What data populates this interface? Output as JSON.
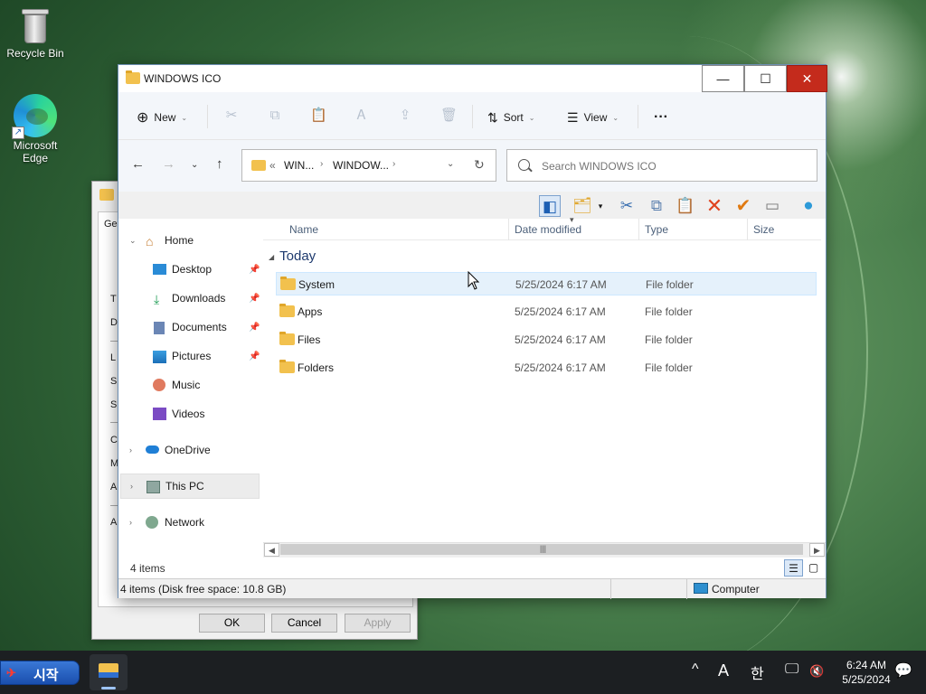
{
  "desktop": {
    "icons": [
      {
        "label": "Recycle Bin",
        "icon": "recycle-bin-icon"
      },
      {
        "label": "Microsoft\nEdge",
        "icon": "edge-icon"
      }
    ]
  },
  "background_dialog": {
    "tab": "Ge",
    "labels": [
      "T",
      "D",
      "L",
      "S",
      "S",
      "C",
      "M",
      "A",
      "A"
    ],
    "buttons": {
      "ok": "OK",
      "cancel": "Cancel",
      "apply": "Apply"
    }
  },
  "window": {
    "title": "WINDOWS ICO",
    "controls": {
      "minimize": "—",
      "maximize": "☐",
      "close": "✕"
    }
  },
  "command_bar": {
    "new_label": "New",
    "sort_label": "Sort",
    "view_label": "View",
    "more_label": "···"
  },
  "address": {
    "prefix": "«",
    "crumbs": [
      "WIN...",
      "WINDOW..."
    ],
    "search_placeholder": "Search WINDOWS ICO"
  },
  "nav_pane": {
    "items": [
      {
        "label": "Home",
        "icon": "home-icon",
        "expandable": true,
        "expanded": true
      },
      {
        "label": "Desktop",
        "icon": "desktop-icon",
        "pinned": true
      },
      {
        "label": "Downloads",
        "icon": "downloads-icon",
        "pinned": true
      },
      {
        "label": "Documents",
        "icon": "documents-icon",
        "pinned": true
      },
      {
        "label": "Pictures",
        "icon": "pictures-icon",
        "pinned": true
      },
      {
        "label": "Music",
        "icon": "music-icon"
      },
      {
        "label": "Videos",
        "icon": "videos-icon"
      },
      {
        "label": "OneDrive",
        "icon": "onedrive-icon",
        "expandable": true
      },
      {
        "label": "This PC",
        "icon": "this-pc-icon",
        "expandable": true,
        "selected": true
      },
      {
        "label": "Network",
        "icon": "network-icon",
        "expandable": true
      }
    ]
  },
  "file_list": {
    "columns": [
      "Name",
      "Date modified",
      "Type",
      "Size"
    ],
    "group": "Today",
    "rows": [
      {
        "name": "System",
        "date": "5/25/2024 6:17 AM",
        "type": "File folder"
      },
      {
        "name": "Apps",
        "date": "5/25/2024 6:17 AM",
        "type": "File folder"
      },
      {
        "name": "Files",
        "date": "5/25/2024 6:17 AM",
        "type": "File folder"
      },
      {
        "name": "Folders",
        "date": "5/25/2024 6:17 AM",
        "type": "File folder"
      }
    ]
  },
  "status": {
    "item_count": "4 items",
    "disk_info": "4 items (Disk free space: 10.8 GB)",
    "location": "Computer"
  },
  "taskbar": {
    "start_label": "시작",
    "tray": {
      "chevron": "^",
      "ime_a": "A",
      "ime_han": "한"
    },
    "time": "6:24 AM",
    "date": "5/25/2024"
  },
  "colors": {
    "close_button": "#c42b1c",
    "folder": "#f2c14e",
    "selection": "#e5f1fb",
    "start_button": "#2a62c4"
  }
}
